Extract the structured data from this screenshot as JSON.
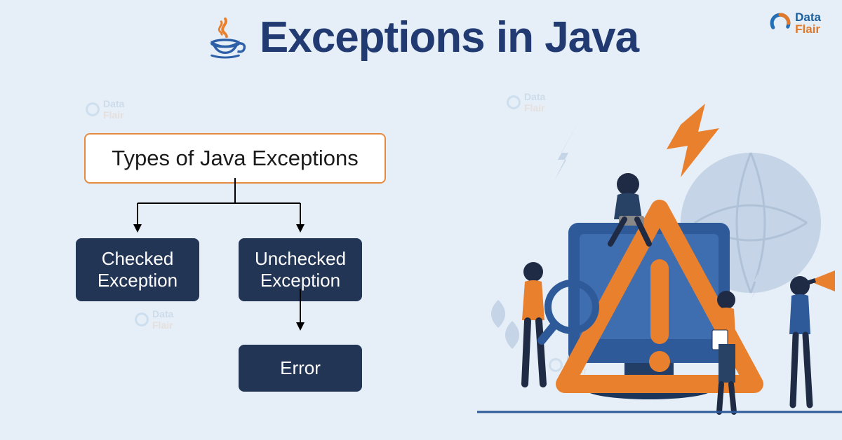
{
  "title": "Exceptions in Java",
  "logo": {
    "top": "Data",
    "bottom": "Flair"
  },
  "diagram": {
    "root": "Types of Java Exceptions",
    "children": [
      {
        "label_line1": "Checked",
        "label_line2": "Exception"
      },
      {
        "label_line1": "Unchecked",
        "label_line2": "Exception"
      }
    ],
    "leaf": "Error"
  },
  "colors": {
    "accent_orange": "#e9802d",
    "dark_navy": "#223555",
    "title_navy": "#213a72",
    "bg": "#e6eef7"
  }
}
